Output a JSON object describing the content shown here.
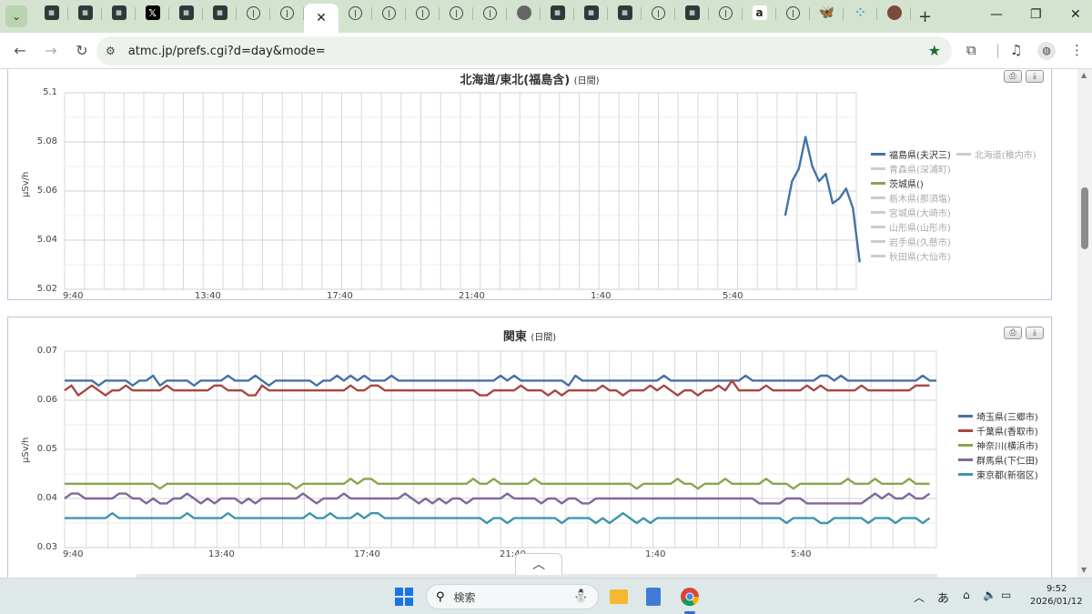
{
  "browser": {
    "tabs": [
      {
        "icon": "site-dark-icon"
      },
      {
        "icon": "site-dark-icon"
      },
      {
        "icon": "site-dark-icon"
      },
      {
        "icon": "x-icon",
        "glyph": "𝕏"
      },
      {
        "icon": "site-dark-icon"
      },
      {
        "icon": "site-dark-icon"
      },
      {
        "icon": "circle-site-icon"
      },
      {
        "icon": "circle-site-icon"
      },
      {
        "icon": "close-icon",
        "active": true,
        "glyph": "✕"
      },
      {
        "icon": "circle-site-icon"
      },
      {
        "icon": "circle-site-icon"
      },
      {
        "icon": "circle-site-icon"
      },
      {
        "icon": "circle-site-icon"
      },
      {
        "icon": "circle-site-icon"
      },
      {
        "icon": "globe-icon"
      },
      {
        "icon": "site-dark-icon"
      },
      {
        "icon": "site-dark-icon"
      },
      {
        "icon": "site-dark-icon"
      },
      {
        "icon": "circle-site-icon"
      },
      {
        "icon": "site-dark-icon"
      },
      {
        "icon": "circle-site-icon"
      },
      {
        "icon": "amazon-icon",
        "glyph": "a"
      },
      {
        "icon": "circle-site-icon"
      },
      {
        "icon": "bluesky-icon",
        "glyph": "🦋"
      },
      {
        "icon": "dots-icon",
        "glyph": "⁘"
      },
      {
        "icon": "user-avatar-icon"
      }
    ],
    "new_tab_glyph": "+",
    "url": "atmc.jp/prefs.cgi?d=day&mode="
  },
  "chart_data": [
    {
      "type": "line",
      "title": "北海道/東北(福島含)",
      "subtitle": "(日間)",
      "ylabel": "μSv/h",
      "yticks": [
        "5.1",
        "5.08",
        "5.06",
        "5.04",
        "5.02"
      ],
      "ylim": [
        5.02,
        5.1
      ],
      "xticks": [
        "9:40",
        "13:40",
        "17:40",
        "21:40",
        "1:40",
        "5:40"
      ],
      "legend": [
        {
          "name": "福島県(夫沢三)",
          "color": "#4572a7",
          "active": true
        },
        {
          "name": "北海道(稚内市)",
          "color": "#cccccc",
          "active": false
        },
        {
          "name": "青森県(深浦町)",
          "color": "#cccccc",
          "active": false
        },
        {
          "name": "茨城県()",
          "color": "#89a54e",
          "active": true
        },
        {
          "name": "栃木県(那須塩)",
          "color": "#cccccc",
          "active": false
        },
        {
          "name": "宮城県(大崎市)",
          "color": "#cccccc",
          "active": false
        },
        {
          "name": "山形県(山形市)",
          "color": "#cccccc",
          "active": false
        },
        {
          "name": "岩手県(久慈市)",
          "color": "#cccccc",
          "active": false
        },
        {
          "name": "秋田県(大仙市)",
          "color": "#cccccc",
          "active": false
        }
      ],
      "series": [
        {
          "name": "福島県(夫沢三)",
          "color": "#4572a7",
          "x_index": [
            107,
            108,
            109,
            110,
            111,
            112,
            113,
            114,
            115,
            116,
            117
          ],
          "values": [
            5.05,
            5.064,
            5.069,
            5.082,
            5.07,
            5.064,
            5.067,
            5.055,
            5.057,
            5.061,
            5.053,
            5.031
          ]
        }
      ],
      "points_total": 118
    },
    {
      "type": "line",
      "title": "関東",
      "subtitle": "(日間)",
      "ylabel": "μSv/h",
      "yticks": [
        "0.07",
        "0.06",
        "0.05",
        "0.04",
        "0.03"
      ],
      "ylim": [
        0.03,
        0.07
      ],
      "xticks": [
        "9:40",
        "13:40",
        "17:40",
        "21:40",
        "1:40",
        "5:40"
      ],
      "legend": [
        {
          "name": "埼玉県(三郷市)",
          "color": "#4572a7",
          "active": true
        },
        {
          "name": "千葉県(香取市)",
          "color": "#aa4643",
          "active": true
        },
        {
          "name": "神奈川(横浜市)",
          "color": "#89a54e",
          "active": true
        },
        {
          "name": "群馬県(下仁田)",
          "color": "#80699b",
          "active": true
        },
        {
          "name": "東京都(新宿区)",
          "color": "#3d96ae",
          "active": true
        }
      ],
      "series": [
        {
          "name": "埼玉県(三郷市)",
          "color": "#4572a7",
          "base": 0.064,
          "values": [
            0.064,
            0.064,
            0.064,
            0.064,
            0.064,
            0.063,
            0.064,
            0.064,
            0.064,
            0.064,
            0.063,
            0.064,
            0.064,
            0.065,
            0.063,
            0.064,
            0.064,
            0.064,
            0.064,
            0.063,
            0.064,
            0.064,
            0.064,
            0.064,
            0.065,
            0.064,
            0.064,
            0.064,
            0.065,
            0.064,
            0.063,
            0.064,
            0.064,
            0.064,
            0.064,
            0.064,
            0.064,
            0.063,
            0.064,
            0.064,
            0.065,
            0.064,
            0.065,
            0.064,
            0.065,
            0.064,
            0.064,
            0.064,
            0.065,
            0.064,
            0.064,
            0.064,
            0.064,
            0.064,
            0.064,
            0.064,
            0.064,
            0.064,
            0.064,
            0.064,
            0.064,
            0.064,
            0.064,
            0.064,
            0.065,
            0.064,
            0.065,
            0.064,
            0.064,
            0.064,
            0.064,
            0.064,
            0.064,
            0.064,
            0.063,
            0.065,
            0.064,
            0.064,
            0.064,
            0.064,
            0.064,
            0.064,
            0.064,
            0.064,
            0.064,
            0.064,
            0.064,
            0.064,
            0.065,
            0.064,
            0.064,
            0.064,
            0.064,
            0.064,
            0.064,
            0.064,
            0.064,
            0.064,
            0.064,
            0.064,
            0.065,
            0.064,
            0.064,
            0.064,
            0.064,
            0.064,
            0.064,
            0.064,
            0.064,
            0.064,
            0.064,
            0.065,
            0.065,
            0.064,
            0.065,
            0.064,
            0.064,
            0.064,
            0.064,
            0.064,
            0.064,
            0.064,
            0.064,
            0.064,
            0.064,
            0.064,
            0.065,
            0.064,
            0.064
          ]
        },
        {
          "name": "千葉県(香取市)",
          "color": "#aa4643",
          "base": 0.062,
          "values": [
            0.062,
            0.063,
            0.061,
            0.062,
            0.063,
            0.062,
            0.061,
            0.062,
            0.062,
            0.063,
            0.062,
            0.062,
            0.062,
            0.062,
            0.062,
            0.063,
            0.062,
            0.062,
            0.062,
            0.062,
            0.062,
            0.062,
            0.063,
            0.063,
            0.062,
            0.062,
            0.062,
            0.061,
            0.061,
            0.063,
            0.062,
            0.062,
            0.062,
            0.062,
            0.062,
            0.062,
            0.062,
            0.062,
            0.062,
            0.062,
            0.062,
            0.062,
            0.063,
            0.062,
            0.062,
            0.063,
            0.063,
            0.062,
            0.062,
            0.062,
            0.062,
            0.062,
            0.062,
            0.062,
            0.062,
            0.062,
            0.062,
            0.062,
            0.062,
            0.062,
            0.062,
            0.061,
            0.061,
            0.062,
            0.062,
            0.062,
            0.062,
            0.063,
            0.062,
            0.062,
            0.062,
            0.061,
            0.062,
            0.061,
            0.062,
            0.062,
            0.062,
            0.062,
            0.062,
            0.063,
            0.062,
            0.062,
            0.061,
            0.062,
            0.062,
            0.062,
            0.063,
            0.062,
            0.063,
            0.062,
            0.061,
            0.062,
            0.062,
            0.061,
            0.062,
            0.062,
            0.063,
            0.062,
            0.064,
            0.062,
            0.062,
            0.062,
            0.062,
            0.063,
            0.062,
            0.062,
            0.062,
            0.062,
            0.062,
            0.063,
            0.062,
            0.063,
            0.062,
            0.062,
            0.062,
            0.062,
            0.062,
            0.063,
            0.062,
            0.062,
            0.062,
            0.062,
            0.062,
            0.062,
            0.062,
            0.063,
            0.063,
            0.063
          ]
        },
        {
          "name": "神奈川(横浜市)",
          "color": "#89a54e",
          "base": 0.043,
          "values": [
            0.043,
            0.043,
            0.043,
            0.043,
            0.043,
            0.043,
            0.043,
            0.043,
            0.043,
            0.043,
            0.043,
            0.043,
            0.043,
            0.043,
            0.042,
            0.043,
            0.043,
            0.043,
            0.043,
            0.043,
            0.043,
            0.043,
            0.043,
            0.043,
            0.043,
            0.043,
            0.043,
            0.043,
            0.043,
            0.043,
            0.043,
            0.043,
            0.043,
            0.043,
            0.042,
            0.043,
            0.043,
            0.043,
            0.043,
            0.043,
            0.043,
            0.043,
            0.044,
            0.043,
            0.044,
            0.044,
            0.043,
            0.043,
            0.043,
            0.043,
            0.043,
            0.043,
            0.043,
            0.043,
            0.043,
            0.043,
            0.043,
            0.043,
            0.043,
            0.043,
            0.044,
            0.043,
            0.043,
            0.044,
            0.043,
            0.043,
            0.043,
            0.043,
            0.043,
            0.044,
            0.043,
            0.043,
            0.043,
            0.043,
            0.043,
            0.043,
            0.043,
            0.043,
            0.043,
            0.043,
            0.043,
            0.043,
            0.043,
            0.043,
            0.042,
            0.043,
            0.043,
            0.043,
            0.043,
            0.043,
            0.044,
            0.043,
            0.043,
            0.042,
            0.043,
            0.043,
            0.043,
            0.044,
            0.043,
            0.043,
            0.043,
            0.043,
            0.043,
            0.044,
            0.043,
            0.043,
            0.043,
            0.042,
            0.043,
            0.043,
            0.043,
            0.043,
            0.043,
            0.043,
            0.043,
            0.044,
            0.043,
            0.043,
            0.043,
            0.044,
            0.043,
            0.043,
            0.043,
            0.043,
            0.044,
            0.043,
            0.043,
            0.043
          ]
        },
        {
          "name": "群馬県(下仁田)",
          "color": "#80699b",
          "base": 0.04,
          "values": [
            0.04,
            0.041,
            0.041,
            0.04,
            0.04,
            0.04,
            0.04,
            0.04,
            0.041,
            0.041,
            0.04,
            0.04,
            0.039,
            0.04,
            0.039,
            0.039,
            0.04,
            0.04,
            0.041,
            0.04,
            0.039,
            0.04,
            0.039,
            0.04,
            0.04,
            0.04,
            0.039,
            0.04,
            0.039,
            0.04,
            0.04,
            0.04,
            0.04,
            0.04,
            0.04,
            0.041,
            0.04,
            0.039,
            0.04,
            0.04,
            0.04,
            0.041,
            0.04,
            0.04,
            0.04,
            0.04,
            0.04,
            0.04,
            0.04,
            0.04,
            0.041,
            0.04,
            0.039,
            0.04,
            0.039,
            0.04,
            0.039,
            0.04,
            0.04,
            0.039,
            0.04,
            0.04,
            0.04,
            0.04,
            0.04,
            0.041,
            0.04,
            0.04,
            0.04,
            0.04,
            0.039,
            0.04,
            0.04,
            0.039,
            0.04,
            0.04,
            0.039,
            0.039,
            0.04,
            0.04,
            0.04,
            0.04,
            0.04,
            0.04,
            0.04,
            0.04,
            0.04,
            0.04,
            0.04,
            0.04,
            0.04,
            0.04,
            0.04,
            0.04,
            0.04,
            0.04,
            0.04,
            0.04,
            0.04,
            0.04,
            0.04,
            0.04,
            0.039,
            0.039,
            0.039,
            0.039,
            0.04,
            0.04,
            0.04,
            0.039,
            0.039,
            0.039,
            0.039,
            0.039,
            0.039,
            0.039,
            0.039,
            0.039,
            0.04,
            0.041,
            0.04,
            0.041,
            0.04,
            0.04,
            0.041,
            0.04,
            0.04,
            0.041
          ]
        },
        {
          "name": "東京都(新宿区)",
          "color": "#3d96ae",
          "base": 0.036,
          "values": [
            0.036,
            0.036,
            0.036,
            0.036,
            0.036,
            0.036,
            0.036,
            0.037,
            0.036,
            0.036,
            0.036,
            0.036,
            0.036,
            0.036,
            0.036,
            0.036,
            0.036,
            0.036,
            0.037,
            0.036,
            0.036,
            0.036,
            0.036,
            0.036,
            0.037,
            0.036,
            0.036,
            0.036,
            0.036,
            0.036,
            0.036,
            0.036,
            0.036,
            0.036,
            0.036,
            0.036,
            0.037,
            0.036,
            0.036,
            0.037,
            0.036,
            0.036,
            0.036,
            0.037,
            0.036,
            0.037,
            0.037,
            0.036,
            0.036,
            0.036,
            0.036,
            0.036,
            0.036,
            0.036,
            0.036,
            0.036,
            0.036,
            0.036,
            0.036,
            0.036,
            0.036,
            0.036,
            0.035,
            0.036,
            0.036,
            0.035,
            0.036,
            0.036,
            0.036,
            0.036,
            0.036,
            0.036,
            0.036,
            0.035,
            0.036,
            0.036,
            0.036,
            0.036,
            0.035,
            0.036,
            0.035,
            0.036,
            0.037,
            0.036,
            0.035,
            0.036,
            0.035,
            0.036,
            0.036,
            0.036,
            0.036,
            0.036,
            0.036,
            0.036,
            0.036,
            0.036,
            0.036,
            0.036,
            0.036,
            0.036,
            0.036,
            0.036,
            0.036,
            0.036,
            0.036,
            0.036,
            0.035,
            0.036,
            0.036,
            0.036,
            0.036,
            0.035,
            0.035,
            0.036,
            0.036,
            0.036,
            0.036,
            0.036,
            0.035,
            0.036,
            0.036,
            0.036,
            0.035,
            0.036,
            0.036,
            0.036,
            0.035,
            0.036
          ]
        }
      ]
    }
  ],
  "taskbar": {
    "search_placeholder": "検索",
    "ime": "あ",
    "time": "9:52",
    "date": "2026/01/12"
  },
  "export_buttons": {
    "print_glyph": "⎙",
    "download_glyph": "⤓"
  }
}
